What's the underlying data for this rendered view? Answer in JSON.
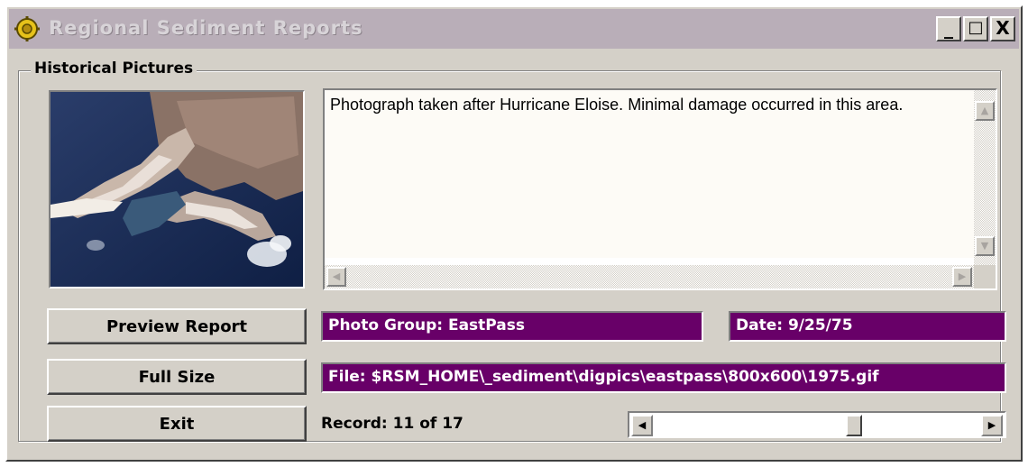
{
  "window": {
    "title": "Regional Sediment Reports",
    "caption_buttons": {
      "minimize": "_",
      "maximize": "□",
      "close": "X"
    }
  },
  "group": {
    "label": "Historical Pictures"
  },
  "photo": {
    "icon": "aerial-photo"
  },
  "description": {
    "text": "Photograph taken after Hurricane Eloise. Minimal damage occurred in this area."
  },
  "buttons": {
    "preview": "Preview Report",
    "full_size": "Full Size",
    "exit": "Exit"
  },
  "fields": {
    "photo_group": "Photo Group: EastPass",
    "date": "Date: 9/25/75",
    "file": "File: $RSM_HOME\\_sediment\\digpics\\eastpass\\800x600\\1975.gif"
  },
  "navigator": {
    "record_text": "Record: 11 of 17",
    "current": 11,
    "total": 17
  },
  "colors": {
    "field_bg": "#680068",
    "titlebar_bg": "#b9aeb8",
    "window_bg": "#d4d0c8"
  }
}
